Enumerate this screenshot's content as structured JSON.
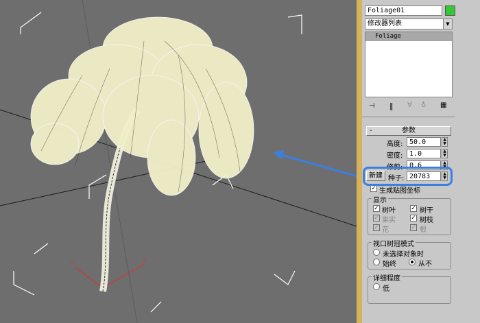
{
  "panel": {
    "object_name": "Foliage01",
    "object_color": "#34c934",
    "modifier_list": "修改器列表",
    "stack_item": "Foliage",
    "rollout_title": "参数",
    "params": {
      "height_label": "高度:",
      "height_value": "50.0",
      "density_label": "密度:",
      "density_value": "1.0",
      "prune_label": "修剪:",
      "prune_value": "0.6",
      "new_button": "新建",
      "seed_label": "种子:",
      "seed_value": "20783",
      "gen_mapping_label": "生成贴图坐标"
    },
    "display": {
      "title": "显示",
      "leaves": "树叶",
      "trunk": "树干",
      "fruit": "果实",
      "branches": "树枝",
      "flowers": "花",
      "roots": "根"
    },
    "canopy": {
      "title": "视口树冠模式",
      "when_not_selected": "未选择对象时",
      "always": "始终",
      "never": "从不"
    },
    "detail": {
      "title": "详细程度",
      "low": "低"
    }
  },
  "colors": {
    "accent_highlight": "#3b7fe0",
    "panel_bg": "#c8c8c8",
    "viewport_bg": "#6e6e6e",
    "foliage": "#f2f0c8"
  },
  "icons": [
    "pin-icon",
    "show-end-result-icon",
    "make-unique-icon",
    "remove-modifier-icon",
    "configure-sets-icon"
  ]
}
